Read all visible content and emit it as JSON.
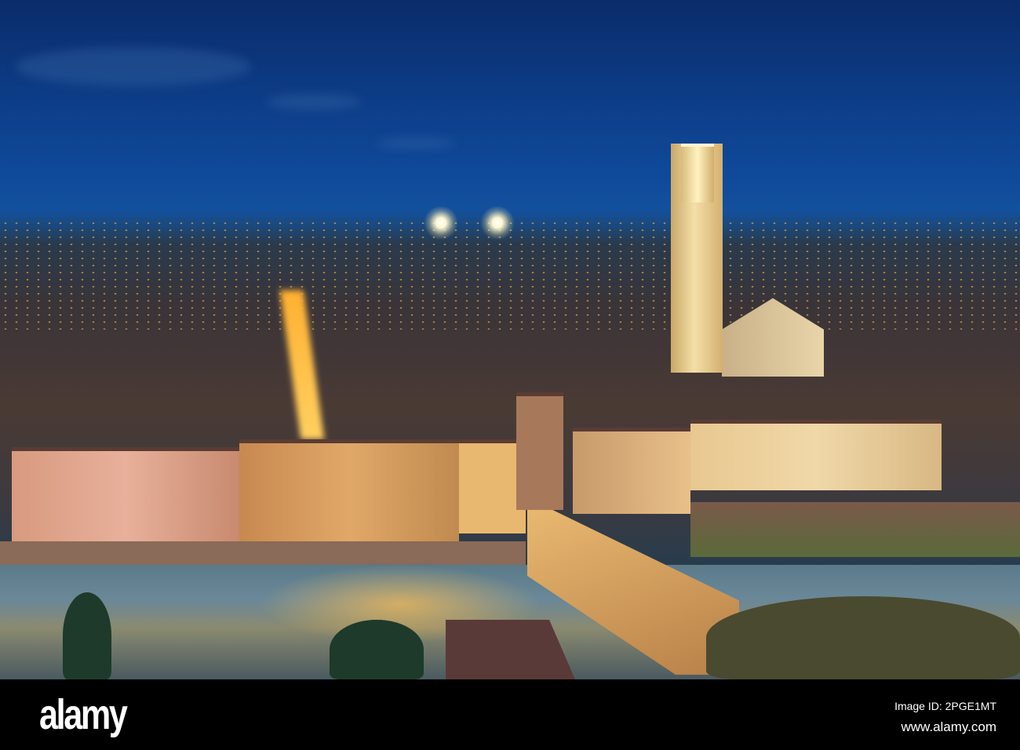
{
  "photo": {
    "subject": "city-skyline-at-dusk"
  },
  "watermark": {
    "logo": "alamy",
    "image_id": "Image ID: 2PGE1MT",
    "url": "www.alamy.com"
  }
}
